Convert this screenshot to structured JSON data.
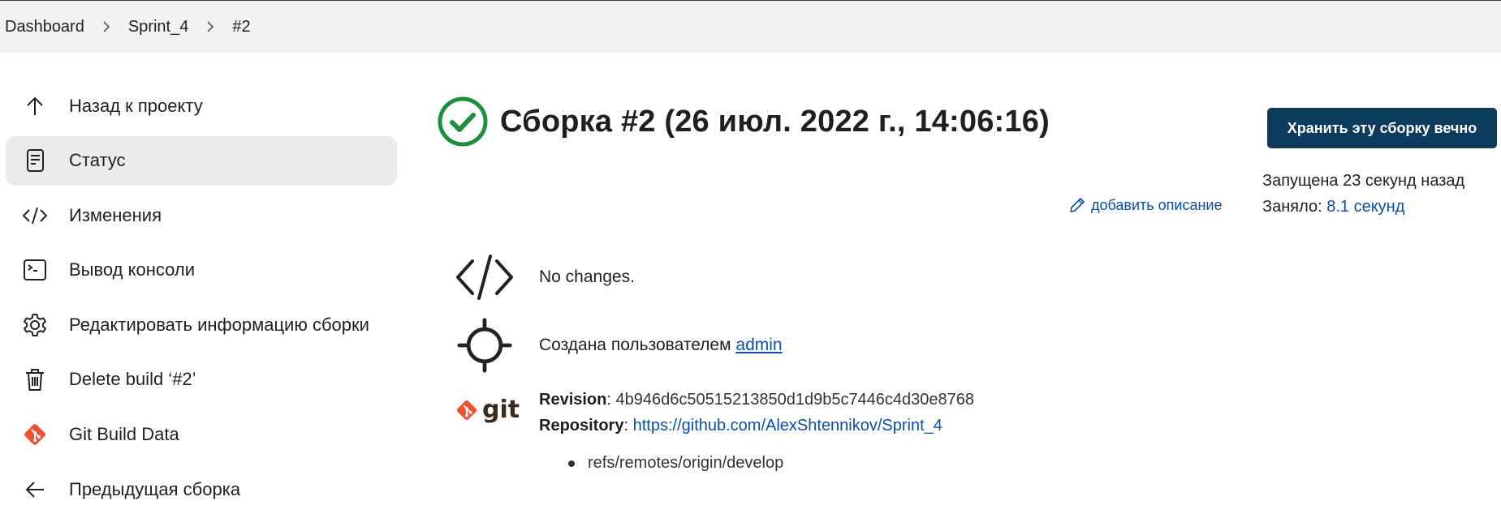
{
  "breadcrumb": [
    "Dashboard",
    "Sprint_4",
    "#2"
  ],
  "sidebar": {
    "items": [
      {
        "label": "Назад к проекту",
        "icon": "arrow-up-icon"
      },
      {
        "label": "Статус",
        "icon": "document-icon",
        "active": true
      },
      {
        "label": "Изменения",
        "icon": "code-icon"
      },
      {
        "label": "Вывод консоли",
        "icon": "terminal-icon"
      },
      {
        "label": "Редактировать информацию сборки",
        "icon": "gear-icon"
      },
      {
        "label": "Delete build ‘#2’",
        "icon": "trash-icon"
      },
      {
        "label": "Git Build Data",
        "icon": "git-icon"
      },
      {
        "label": "Предыдущая сборка",
        "icon": "arrow-left-icon"
      }
    ]
  },
  "build": {
    "title": "Сборка #2 (26 июл. 2022 г., 14:06:16)",
    "status": "success",
    "keep_button": "Хранить эту сборку вечно",
    "started": "Запущена 23 секунд назад",
    "took_label": "Заняло:",
    "took_value": "8.1 секунд",
    "add_description": "добавить описание"
  },
  "changes": {
    "text": "No changes."
  },
  "cause": {
    "prefix": "Создана пользователем",
    "user": "admin"
  },
  "git": {
    "logo_word": "git",
    "revision_label": "Revision",
    "revision": "4b946d6c50515213850d1d9b5c7446c4d30e8768",
    "repository_label": "Repository",
    "repository": "https://github.com/AlexShtennikov/Sprint_4",
    "refs": [
      "refs/remotes/origin/develop"
    ]
  },
  "colors": {
    "success": "#1e8f3f",
    "primary_button": "#0b3c5d",
    "link": "#0b4fa8",
    "git": "#f05133"
  }
}
